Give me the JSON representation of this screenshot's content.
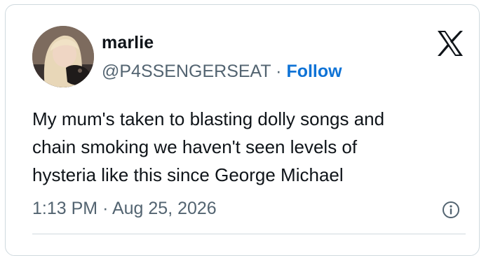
{
  "tweet": {
    "author_name": "marlie",
    "author_handle": "@P4SSENGERSEAT",
    "separator": "·",
    "follow_label": "Follow",
    "text_lines": [
      "My mum's taken to blasting dolly songs and",
      "chain smoking we haven't seen levels of",
      "hysteria like this since George Michael"
    ],
    "time": "1:13 PM",
    "date": "Aug 25, 2026"
  },
  "icons": {
    "platform_logo": "x-logo-icon",
    "info": "info-icon"
  },
  "colors": {
    "text_primary": "#0f1419",
    "text_secondary": "#536471",
    "follow_blue": "#0f73d6",
    "border": "#cfd9de"
  }
}
